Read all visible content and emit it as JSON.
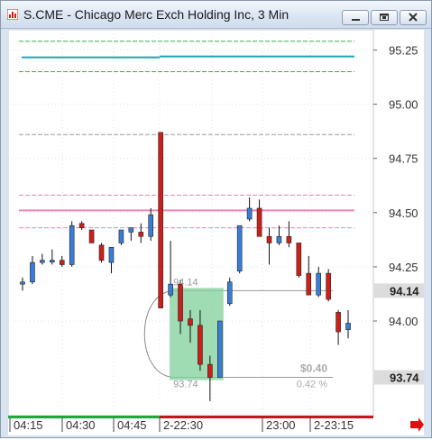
{
  "window": {
    "title": "S.CME - Chicago Merc Exch Holding Inc, 3 Min",
    "icons": [
      "app-icon",
      "minimize-icon",
      "restore-icon",
      "close-icon"
    ]
  },
  "colors": {
    "up": "#3a7dd6",
    "down": "#cc1f1a",
    "grid": "#e0e0e0",
    "green_line": "#2fb34a",
    "teal_line": "#1aa6b7",
    "pink_line": "#e985b9",
    "gray_line": "#9a9a9a",
    "measure_fill": "#7fcf9a",
    "price_tag_bg": "#dcdcdc",
    "time_bar_green": "#1ea83a",
    "time_bar_red": "#c8141a"
  },
  "y_axis": {
    "min": 93.63,
    "max": 95.31,
    "ticks": [
      {
        "value": 95.25,
        "label": "95.25"
      },
      {
        "value": 95.0,
        "label": "95.00"
      },
      {
        "value": 94.75,
        "label": "94.75"
      },
      {
        "value": 94.5,
        "label": "94.50"
      },
      {
        "value": 94.25,
        "label": "94.25"
      },
      {
        "value": 94.0,
        "label": "94.00"
      }
    ],
    "price_tags": [
      {
        "value": 94.14,
        "label": "94.14"
      },
      {
        "value": 93.74,
        "label": "93.74"
      }
    ]
  },
  "x_axis": {
    "labels": [
      "04:15",
      "04:30",
      "04:45",
      "2-22:30",
      "23:00",
      "2-23:15"
    ]
  },
  "chart_data": {
    "type": "candlestick",
    "title": "S.CME - Chicago Merc Exch Holding Inc, 3 Min",
    "xlabel": "",
    "ylabel": "",
    "ylim": [
      93.63,
      95.31
    ],
    "x_tick_labels": [
      "04:15",
      "04:30",
      "04:45",
      "2-22:30",
      "23:00",
      "2-23:15"
    ],
    "series": [
      {
        "candles": [
          {
            "o": 94.17,
            "h": 94.2,
            "l": 94.14,
            "c": 94.18
          },
          {
            "o": 94.18,
            "h": 94.3,
            "l": 94.17,
            "c": 94.27
          },
          {
            "o": 94.27,
            "h": 94.31,
            "l": 94.26,
            "c": 94.28
          },
          {
            "o": 94.28,
            "h": 94.33,
            "l": 94.26,
            "c": 94.28
          },
          {
            "o": 94.28,
            "h": 94.3,
            "l": 94.25,
            "c": 94.26
          },
          {
            "o": 94.26,
            "h": 94.46,
            "l": 94.25,
            "c": 94.44
          },
          {
            "o": 94.45,
            "h": 94.46,
            "l": 94.42,
            "c": 94.43
          },
          {
            "o": 94.42,
            "h": 94.42,
            "l": 94.36,
            "c": 94.36
          },
          {
            "o": 94.35,
            "h": 94.36,
            "l": 94.27,
            "c": 94.28
          },
          {
            "o": 94.27,
            "h": 94.33,
            "l": 94.22,
            "c": 94.34
          },
          {
            "o": 94.36,
            "h": 94.42,
            "l": 94.35,
            "c": 94.42
          },
          {
            "o": 94.41,
            "h": 94.43,
            "l": 94.37,
            "c": 94.43
          },
          {
            "o": 94.41,
            "h": 94.45,
            "l": 94.36,
            "c": 94.39
          },
          {
            "o": 94.39,
            "h": 94.52,
            "l": 94.37,
            "c": 94.49
          },
          {
            "o": 94.87,
            "h": 94.87,
            "l": 94.06,
            "c": 94.06
          },
          {
            "o": 94.12,
            "h": 94.37,
            "l": 94.11,
            "c": 94.17
          },
          {
            "o": 94.17,
            "h": 94.19,
            "l": 93.94,
            "c": 94.0
          },
          {
            "o": 94.01,
            "h": 94.05,
            "l": 93.9,
            "c": 93.98
          },
          {
            "o": 93.98,
            "h": 94.05,
            "l": 93.77,
            "c": 93.8
          },
          {
            "o": 93.8,
            "h": 93.84,
            "l": 93.63,
            "c": 93.74
          },
          {
            "o": 93.74,
            "h": 94.0,
            "l": 93.74,
            "c": 94.0
          },
          {
            "o": 94.08,
            "h": 94.2,
            "l": 94.07,
            "c": 94.18
          },
          {
            "o": 94.23,
            "h": 94.44,
            "l": 94.22,
            "c": 94.44
          },
          {
            "o": 94.47,
            "h": 94.57,
            "l": 94.46,
            "c": 94.52
          },
          {
            "o": 94.52,
            "h": 94.56,
            "l": 94.39,
            "c": 94.39
          },
          {
            "o": 94.39,
            "h": 94.43,
            "l": 94.26,
            "c": 94.36
          },
          {
            "o": 94.36,
            "h": 94.44,
            "l": 94.35,
            "c": 94.39
          },
          {
            "o": 94.39,
            "h": 94.46,
            "l": 94.34,
            "c": 94.36
          },
          {
            "o": 94.36,
            "h": 94.36,
            "l": 94.2,
            "c": 94.21
          },
          {
            "o": 94.22,
            "h": 94.3,
            "l": 94.13,
            "c": 94.12
          },
          {
            "o": 94.12,
            "h": 94.25,
            "l": 94.11,
            "c": 94.22
          },
          {
            "o": 94.22,
            "h": 94.24,
            "l": 94.09,
            "c": 94.1
          },
          {
            "o": 94.04,
            "h": 94.05,
            "l": 93.89,
            "c": 93.95
          },
          {
            "o": 93.96,
            "h": 94.05,
            "l": 93.92,
            "c": 93.99
          }
        ]
      }
    ],
    "horizontal_lines": [
      {
        "value": 95.29,
        "color": "green_line",
        "style": "dashed"
      },
      {
        "value": 95.22,
        "color": "teal_line",
        "style": "solid"
      },
      {
        "value": 95.15,
        "color": "green_line",
        "style": "dashed"
      },
      {
        "value": 94.86,
        "color": "gray_line",
        "style": "dashed"
      },
      {
        "value": 94.58,
        "color": "pink_line",
        "style": "dashed"
      },
      {
        "value": 94.51,
        "color": "pink_line",
        "style": "solid"
      },
      {
        "value": 94.43,
        "color": "pink_line",
        "style": "dashed"
      }
    ],
    "measure_tool": {
      "from_price": 94.14,
      "to_price": 93.74,
      "from_label": "94.14",
      "to_label": "93.74",
      "change_label": "$0.40",
      "percent_label": "0.42 %",
      "start_candle": 15,
      "end_candle": 20
    },
    "grid": true,
    "legend": "none"
  }
}
